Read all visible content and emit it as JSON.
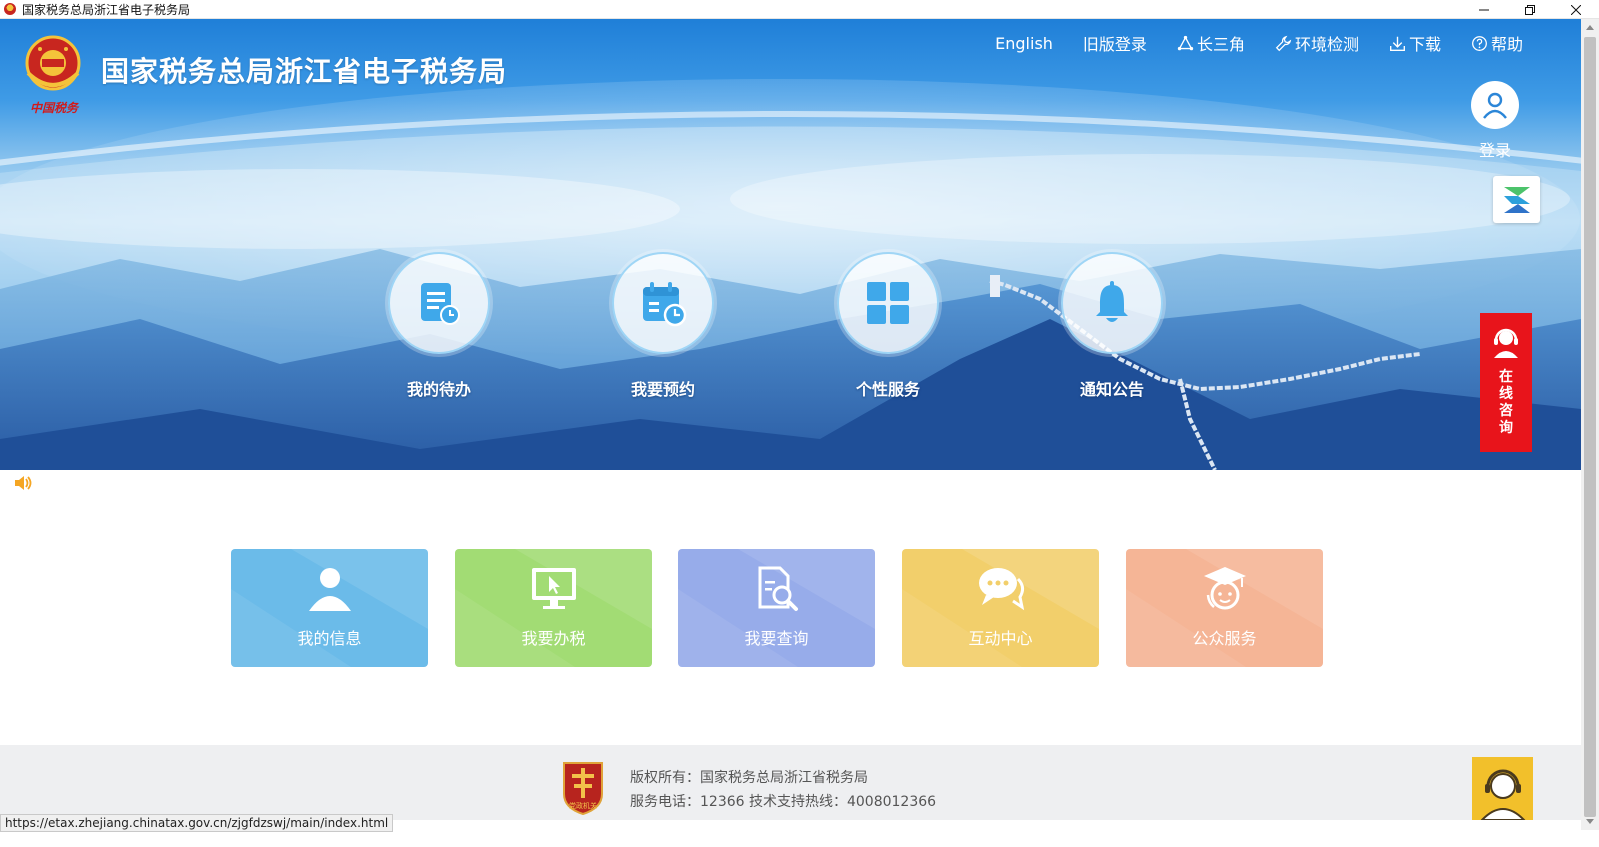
{
  "window": {
    "title": "国家税务总局浙江省电子税务局",
    "icon": "tax-emblem-icon"
  },
  "header": {
    "brand_title": "国家税务总局浙江省电子税务局",
    "emblem_caption": "中国税务",
    "nav": [
      {
        "label": "English",
        "icon": ""
      },
      {
        "label": "旧版登录",
        "icon": ""
      },
      {
        "label": "长三角",
        "icon": "triangle-nodes-icon"
      },
      {
        "label": "环境检测",
        "icon": "wrench-icon"
      },
      {
        "label": "下载",
        "icon": "download-icon"
      },
      {
        "label": "帮助",
        "icon": "help-circle-icon"
      }
    ],
    "login_label": "登录"
  },
  "hero": {
    "circles": [
      {
        "label": "我的待办",
        "icon": "todo-document-icon"
      },
      {
        "label": "我要预约",
        "icon": "calendar-clock-icon"
      },
      {
        "label": "个性服务",
        "icon": "grid-squares-icon"
      },
      {
        "label": "通知公告",
        "icon": "bell-icon"
      }
    ]
  },
  "side": {
    "consult_label": "在线咨询"
  },
  "tiles": [
    {
      "label": "我的信息",
      "icon": "person-icon",
      "color": "#6bbbe9"
    },
    {
      "label": "我要办税",
      "icon": "monitor-cursor-icon",
      "color": "#a2dc74"
    },
    {
      "label": "我要查询",
      "icon": "document-search-icon",
      "color": "#97acea"
    },
    {
      "label": "互动中心",
      "icon": "chat-bubbles-icon",
      "color": "#f2cf6b"
    },
    {
      "label": "公众服务",
      "icon": "graduate-icon",
      "color": "#f5b596"
    }
  ],
  "footer": {
    "copyright": "版权所有：国家税务总局浙江省税务局",
    "service": "服务电话：12366 技术支持热线：4008012366",
    "seal_text": "党政机关"
  },
  "statusbar": {
    "url": "https://etax.zhejiang.chinatax.gov.cn/zjgfdzswj/main/index.html"
  }
}
